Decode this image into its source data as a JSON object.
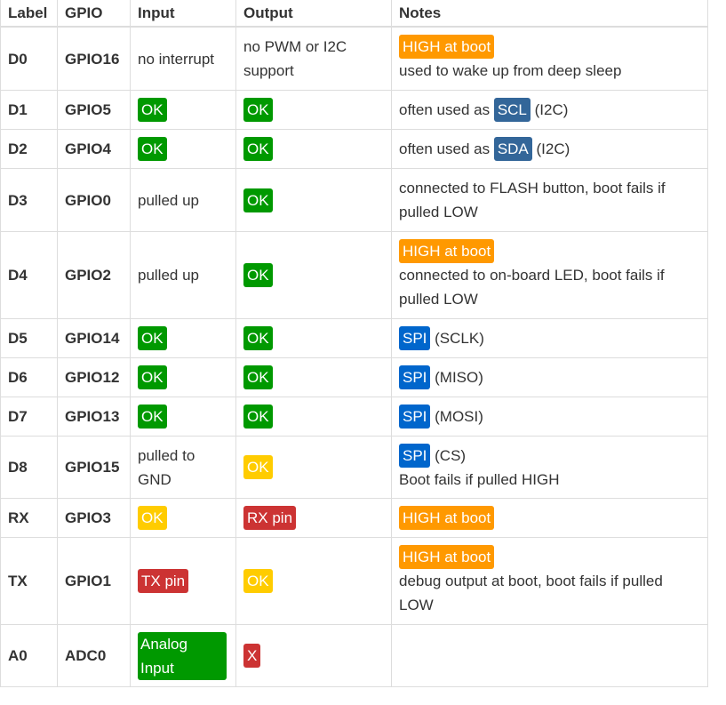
{
  "colors": {
    "ok": "#009900",
    "boot": "#ff9900",
    "caution": "#ffcc00",
    "bad": "#cc3333",
    "i2c": "#336699",
    "spi": "#0066cc"
  },
  "headers": [
    "Label",
    "GPIO",
    "Input",
    "Output",
    "Notes"
  ],
  "rows": [
    {
      "label": "D0",
      "gpio": "GPIO16",
      "input": "no interrupt",
      "output": "no PWM or I2C support",
      "note_badge": "HIGH at boot",
      "note_text": "used to wake up from deep sleep"
    },
    {
      "label": "D1",
      "gpio": "GPIO5",
      "input": "OK",
      "output": "OK",
      "note_prefix": "often used as",
      "note_badge": "SCL",
      "note_suffix": "(I2C)"
    },
    {
      "label": "D2",
      "gpio": "GPIO4",
      "input": "OK",
      "output": "OK",
      "note_prefix": "often used as",
      "note_badge": "SDA",
      "note_suffix": "(I2C)"
    },
    {
      "label": "D3",
      "gpio": "GPIO0",
      "input": "pulled up",
      "output": "OK",
      "note_text": "connected to FLASH button, boot fails if pulled LOW"
    },
    {
      "label": "D4",
      "gpio": "GPIO2",
      "input": "pulled up",
      "output": "OK",
      "note_badge": "HIGH at boot",
      "note_text": "connected to on-board LED, boot fails if pulled LOW"
    },
    {
      "label": "D5",
      "gpio": "GPIO14",
      "input": "OK",
      "output": "OK",
      "note_badge": "SPI",
      "note_suffix": "(SCLK)"
    },
    {
      "label": "D6",
      "gpio": "GPIO12",
      "input": "OK",
      "output": "OK",
      "note_badge": "SPI",
      "note_suffix": "(MISO)"
    },
    {
      "label": "D7",
      "gpio": "GPIO13",
      "input": "OK",
      "output": "OK",
      "note_badge": "SPI",
      "note_suffix": "(MOSI)"
    },
    {
      "label": "D8",
      "gpio": "GPIO15",
      "input": "pulled to GND",
      "output": "OK",
      "note_badge": "SPI",
      "note_suffix": "(CS)",
      "note_text": "Boot fails if pulled HIGH"
    },
    {
      "label": "RX",
      "gpio": "GPIO3",
      "input": "OK",
      "output": "RX pin",
      "note_badge": "HIGH at boot"
    },
    {
      "label": "TX",
      "gpio": "GPIO1",
      "input": "TX pin",
      "output": "OK",
      "note_badge": "HIGH at boot",
      "note_text": "debug output at boot, boot fails if pulled LOW"
    },
    {
      "label": "A0",
      "gpio": "ADC0",
      "input": "Analog Input",
      "output": "X"
    }
  ]
}
